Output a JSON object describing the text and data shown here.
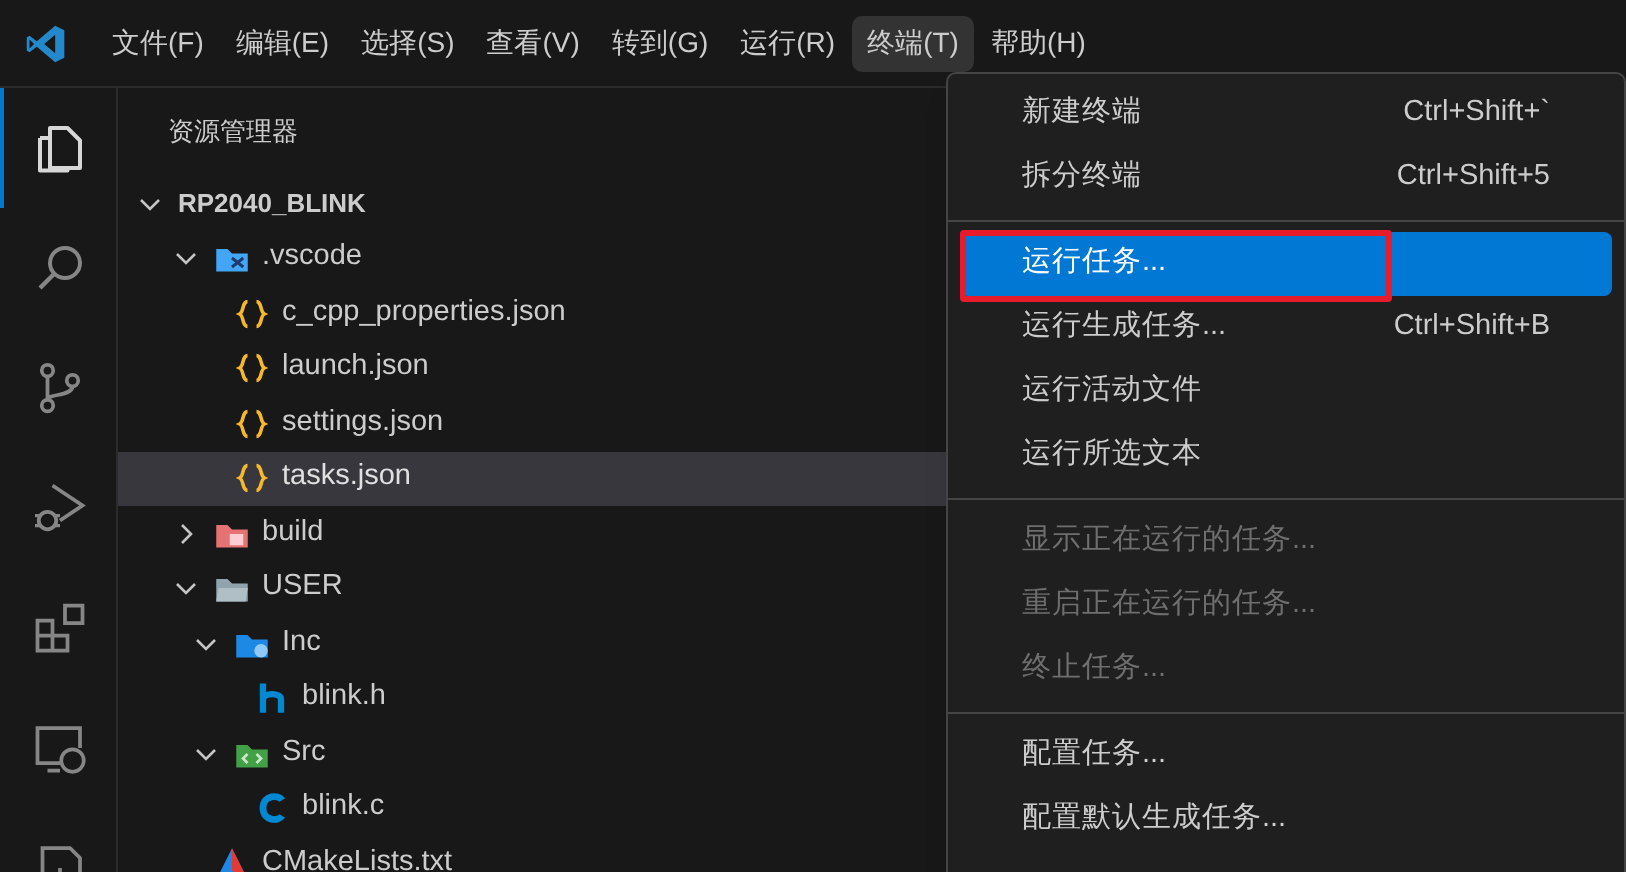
{
  "menu_bar": [
    {
      "label": "文件(F)",
      "selected": false
    },
    {
      "label": "编辑(E)",
      "selected": false
    },
    {
      "label": "选择(S)",
      "selected": false
    },
    {
      "label": "查看(V)",
      "selected": false
    },
    {
      "label": "转到(G)",
      "selected": false
    },
    {
      "label": "运行(R)",
      "selected": false
    },
    {
      "label": "终端(T)",
      "selected": true
    },
    {
      "label": "帮助(H)",
      "selected": false
    }
  ],
  "activity_bar": [
    {
      "kind": "explorer",
      "selected": true
    },
    {
      "kind": "search",
      "selected": false
    },
    {
      "kind": "source-control",
      "selected": false
    },
    {
      "kind": "run-debug",
      "selected": false
    },
    {
      "kind": "extensions",
      "selected": false
    },
    {
      "kind": "remote",
      "selected": false
    },
    {
      "kind": "cmake",
      "selected": false
    }
  ],
  "sidebar": {
    "title": "资源管理器",
    "tree": [
      {
        "label": "RP2040_BLINK",
        "kind": "root",
        "expanded": true,
        "selected": false,
        "children": [
          {
            "label": ".vscode",
            "kind": "folder-vscode",
            "expanded": true,
            "selected": false,
            "children": [
              {
                "label": "c_cpp_properties.json",
                "kind": "json",
                "selected": false
              },
              {
                "label": "launch.json",
                "kind": "json",
                "selected": false
              },
              {
                "label": "settings.json",
                "kind": "json",
                "selected": false
              },
              {
                "label": "tasks.json",
                "kind": "json",
                "selected": true
              }
            ]
          },
          {
            "label": "build",
            "kind": "folder-build",
            "expanded": false,
            "selected": false
          },
          {
            "label": "USER",
            "kind": "folder",
            "expanded": true,
            "selected": false,
            "children": [
              {
                "label": "Inc",
                "kind": "folder-inc",
                "expanded": true,
                "selected": false,
                "children": [
                  {
                    "label": "blink.h",
                    "kind": "h",
                    "selected": false
                  }
                ]
              },
              {
                "label": "Src",
                "kind": "folder-src",
                "expanded": true,
                "selected": false,
                "children": [
                  {
                    "label": "blink.c",
                    "kind": "c",
                    "selected": false
                  }
                ]
              }
            ]
          },
          {
            "label": "CMakeLists.txt",
            "kind": "cmake",
            "selected": false
          }
        ]
      }
    ]
  },
  "terminal_menu": {
    "groups": [
      [
        {
          "label": "新建终端",
          "shortcut": "Ctrl+Shift+`",
          "disabled": false,
          "selected": false,
          "outlined": false
        },
        {
          "label": "拆分终端",
          "shortcut": "Ctrl+Shift+5",
          "disabled": false,
          "selected": false,
          "outlined": false
        }
      ],
      [
        {
          "label": "运行任务...",
          "disabled": false,
          "selected": true,
          "outlined": true
        },
        {
          "label": "运行生成任务...",
          "shortcut": "Ctrl+Shift+B",
          "disabled": false,
          "selected": false,
          "outlined": false
        },
        {
          "label": "运行活动文件",
          "disabled": false,
          "selected": false,
          "outlined": false
        },
        {
          "label": "运行所选文本",
          "disabled": false,
          "selected": false,
          "outlined": false
        }
      ],
      [
        {
          "label": "显示正在运行的任务...",
          "disabled": true,
          "selected": false,
          "outlined": false
        },
        {
          "label": "重启正在运行的任务...",
          "disabled": true,
          "selected": false,
          "outlined": false
        },
        {
          "label": "终止任务...",
          "disabled": true,
          "selected": false,
          "outlined": false
        }
      ],
      [
        {
          "label": "配置任务...",
          "disabled": false,
          "selected": false,
          "outlined": false
        },
        {
          "label": "配置默认生成任务...",
          "disabled": false,
          "selected": false,
          "outlined": false
        }
      ]
    ]
  }
}
